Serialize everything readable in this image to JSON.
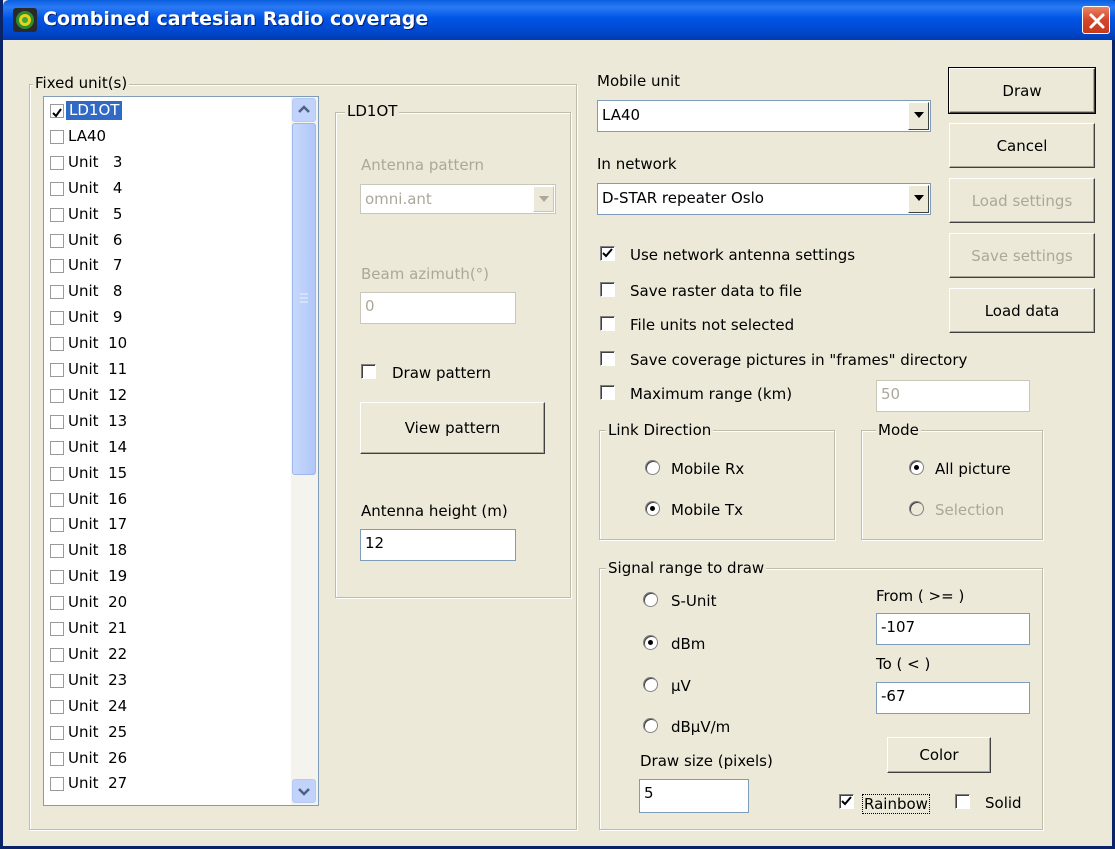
{
  "window": {
    "title": "Combined cartesian Radio coverage"
  },
  "fixed_units": {
    "legend": "Fixed unit(s)",
    "items": [
      {
        "label": "LD1OT",
        "checked": true,
        "selected": true
      },
      {
        "label": "LA40",
        "checked": false
      },
      {
        "label": "Unit   3",
        "checked": false
      },
      {
        "label": "Unit   4",
        "checked": false
      },
      {
        "label": "Unit   5",
        "checked": false
      },
      {
        "label": "Unit   6",
        "checked": false
      },
      {
        "label": "Unit   7",
        "checked": false
      },
      {
        "label": "Unit   8",
        "checked": false
      },
      {
        "label": "Unit   9",
        "checked": false
      },
      {
        "label": "Unit  10",
        "checked": false
      },
      {
        "label": "Unit  11",
        "checked": false
      },
      {
        "label": "Unit  12",
        "checked": false
      },
      {
        "label": "Unit  13",
        "checked": false
      },
      {
        "label": "Unit  14",
        "checked": false
      },
      {
        "label": "Unit  15",
        "checked": false
      },
      {
        "label": "Unit  16",
        "checked": false
      },
      {
        "label": "Unit  17",
        "checked": false
      },
      {
        "label": "Unit  18",
        "checked": false
      },
      {
        "label": "Unit  19",
        "checked": false
      },
      {
        "label": "Unit  20",
        "checked": false
      },
      {
        "label": "Unit  21",
        "checked": false
      },
      {
        "label": "Unit  22",
        "checked": false
      },
      {
        "label": "Unit  23",
        "checked": false
      },
      {
        "label": "Unit  24",
        "checked": false
      },
      {
        "label": "Unit  25",
        "checked": false
      },
      {
        "label": "Unit  26",
        "checked": false
      },
      {
        "label": "Unit  27",
        "checked": false
      }
    ]
  },
  "unit_panel": {
    "legend": "LD1OT",
    "antenna_pattern_label": "Antenna pattern",
    "antenna_pattern_value": "omni.ant",
    "beam_azimuth_label": "Beam azimuth(°)",
    "beam_azimuth_value": "0",
    "draw_pattern_label": "Draw pattern",
    "view_pattern_label": "View pattern",
    "antenna_height_label": "Antenna height (m)",
    "antenna_height_value": "12"
  },
  "mobile": {
    "mobile_unit_label": "Mobile unit",
    "mobile_unit_value": "LA40",
    "in_network_label": "In network",
    "in_network_value": "D-STAR repeater Oslo"
  },
  "options": {
    "use_network_antenna": "Use network antenna settings",
    "save_raster": "Save raster data to file",
    "file_units": "File units not selected",
    "save_coverage": "Save coverage pictures in \"frames\" directory",
    "max_range": "Maximum range (km)",
    "max_range_value": "50"
  },
  "link_direction": {
    "legend": "Link Direction",
    "mobile_rx": "Mobile Rx",
    "mobile_tx": "Mobile Tx"
  },
  "mode": {
    "legend": "Mode",
    "all_picture": "All picture",
    "selection": "Selection"
  },
  "signal_range": {
    "legend": "Signal range to draw",
    "s_unit": "S-Unit",
    "dbm": "dBm",
    "uv": "µV",
    "dbuvm": "dBµV/m",
    "from_label": "From ( >= )",
    "from_value": "-107",
    "to_label": "To ( < )",
    "to_value": "-67",
    "draw_size_label": "Draw size (pixels)",
    "draw_size_value": "5",
    "color_label": "Color",
    "rainbow_label": "Rainbow",
    "solid_label": "Solid"
  },
  "buttons": {
    "draw": "Draw",
    "cancel": "Cancel",
    "load_settings": "Load settings",
    "save_settings": "Save settings",
    "load_data": "Load data"
  },
  "colors": {
    "title_bar": "#0055e5",
    "selection": "#316ac5",
    "dialog_bg": "#ece9d8",
    "close_button": "#d6452a"
  }
}
